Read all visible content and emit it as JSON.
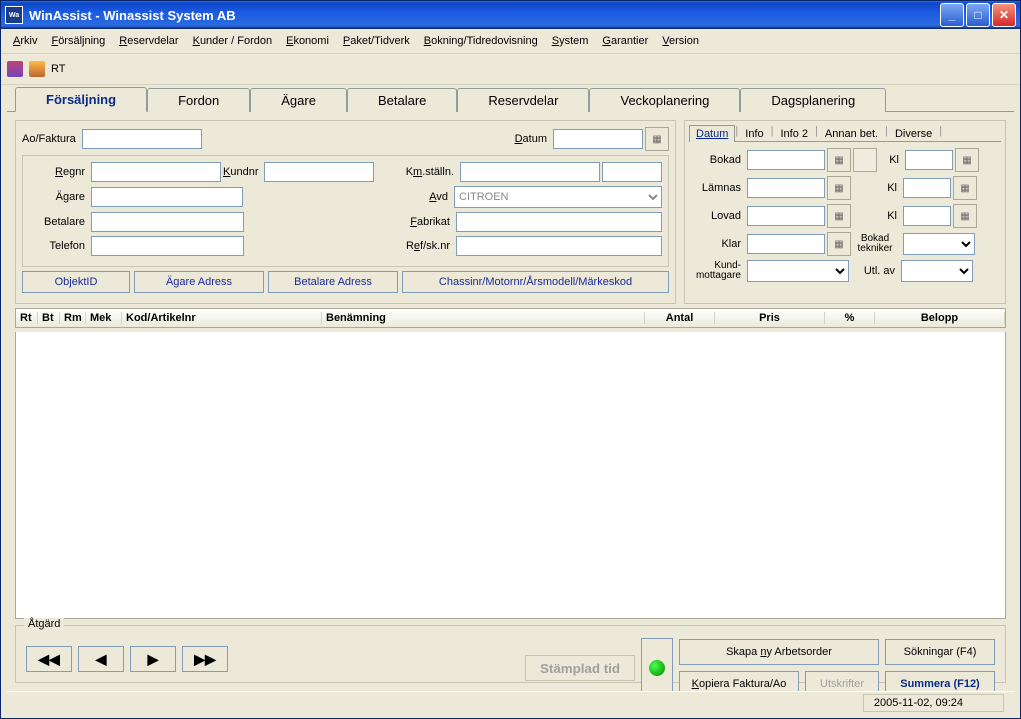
{
  "title": "WinAssist - Winassist System AB",
  "menu": {
    "arkiv": "Arkiv",
    "forsaljning": "Försäljning",
    "reservdelar": "Reservdelar",
    "kunder": "Kunder / Fordon",
    "ekonomi": "Ekonomi",
    "paket": "Paket/Tidverk",
    "bokning": "Bokning/Tidredovisning",
    "system": "System",
    "garantier": "Garantier",
    "version": "Version"
  },
  "toolbar_rt": "RT",
  "main_tabs": {
    "forsaljning": "Försäljning",
    "fordon": "Fordon",
    "agare": "Ägare",
    "betalare": "Betalare",
    "reservdelar": "Reservdelar",
    "veckoplanering": "Veckoplanering",
    "dagsplanering": "Dagsplanering"
  },
  "labels": {
    "ao_faktura": "Ao/Faktura",
    "datum": "Datum",
    "regnr": "Regnr",
    "kundnr": "Kundnr",
    "kmstalln": "Km.ställn.",
    "agare": "Ägare",
    "avd": "Avd",
    "betalare": "Betalare",
    "fabrikat": "Fabrikat",
    "telefon": "Telefon",
    "refsk": "Ref/sk.nr"
  },
  "avd_value": "CITROEN",
  "link_btns": {
    "objektid": "ObjektID",
    "agareadress": "Ägare Adress",
    "betalareadress": "Betalare Adress",
    "chassi": "Chassinr/Motornr/Årsmodell/Märkeskod"
  },
  "sub_tabs": {
    "datum": "Datum",
    "info": "Info",
    "info2": "Info 2",
    "annan": "Annan bet.",
    "diverse": "Diverse"
  },
  "dates": {
    "bokad": "Bokad",
    "lamnas": "Lämnas",
    "lovad": "Lovad",
    "klar": "Klar",
    "kl": "Kl",
    "bokadtek": "Bokad tekniker",
    "kundmot": "Kund-\nmottagare",
    "utlav": "Utl. av"
  },
  "grid_cols": {
    "rt": "Rt",
    "bt": "Bt",
    "rm": "Rm",
    "mek": "Mek",
    "kod": "Kod/Artikelnr",
    "benamning": "Benämning",
    "antal": "Antal",
    "pris": "Pris",
    "pct": "%",
    "belopp": "Belopp"
  },
  "atgard": {
    "legend": "Åtgärd",
    "stamplad": "Stämplad tid",
    "skapa": "Skapa ny Arbetsorder",
    "kopiera": "Kopiera Faktura/Ao",
    "utskrifter": "Utskrifter",
    "sokningar": "Sökningar (F4)",
    "summera": "Summera (F12)"
  },
  "status_time": "2005-11-02, 09:24"
}
